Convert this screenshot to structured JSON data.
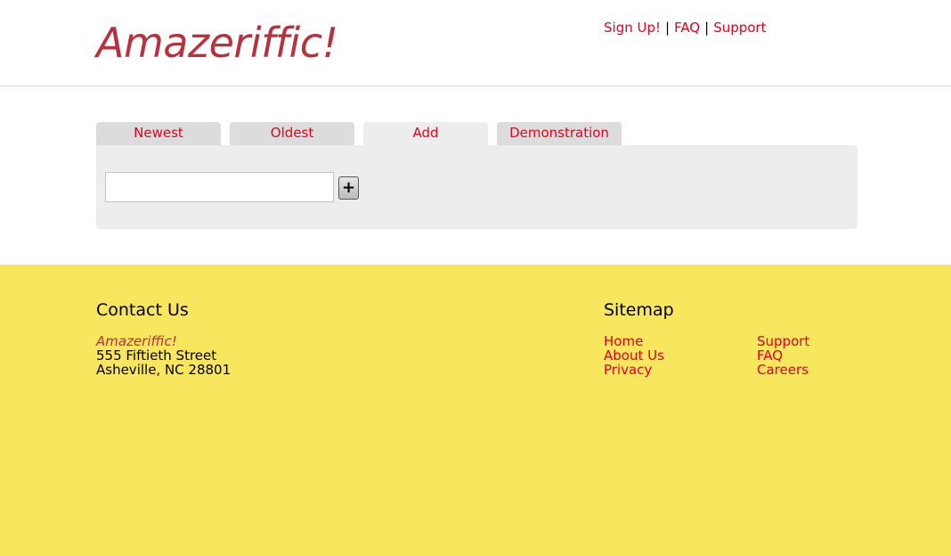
{
  "header": {
    "logo": "Amazeriffic!",
    "nav": [
      {
        "label": "Sign Up!"
      },
      {
        "label": "FAQ"
      },
      {
        "label": "Support"
      }
    ],
    "separator": "|"
  },
  "tabs": [
    {
      "label": "Newest",
      "active": false
    },
    {
      "label": "Oldest",
      "active": false
    },
    {
      "label": "Add",
      "active": true
    },
    {
      "label": "Demonstration",
      "active": false
    }
  ],
  "add_form": {
    "input_value": "",
    "add_button_label": "+"
  },
  "footer": {
    "contact": {
      "heading": "Contact Us",
      "company": "Amazeriffic!",
      "street": "555 Fiftieth Street",
      "city": "Asheville, NC 28801"
    },
    "sitemap": {
      "heading": "Sitemap",
      "col1": [
        "Home",
        "About Us",
        "Privacy"
      ],
      "col2": [
        "Support",
        "FAQ",
        "Careers"
      ]
    }
  },
  "colors": {
    "link": "#e8001c",
    "logo": "#b8323e",
    "footer_bg": "#f7e65e",
    "tab_bg": "#dcdcdc",
    "panel_bg": "#ededed"
  }
}
